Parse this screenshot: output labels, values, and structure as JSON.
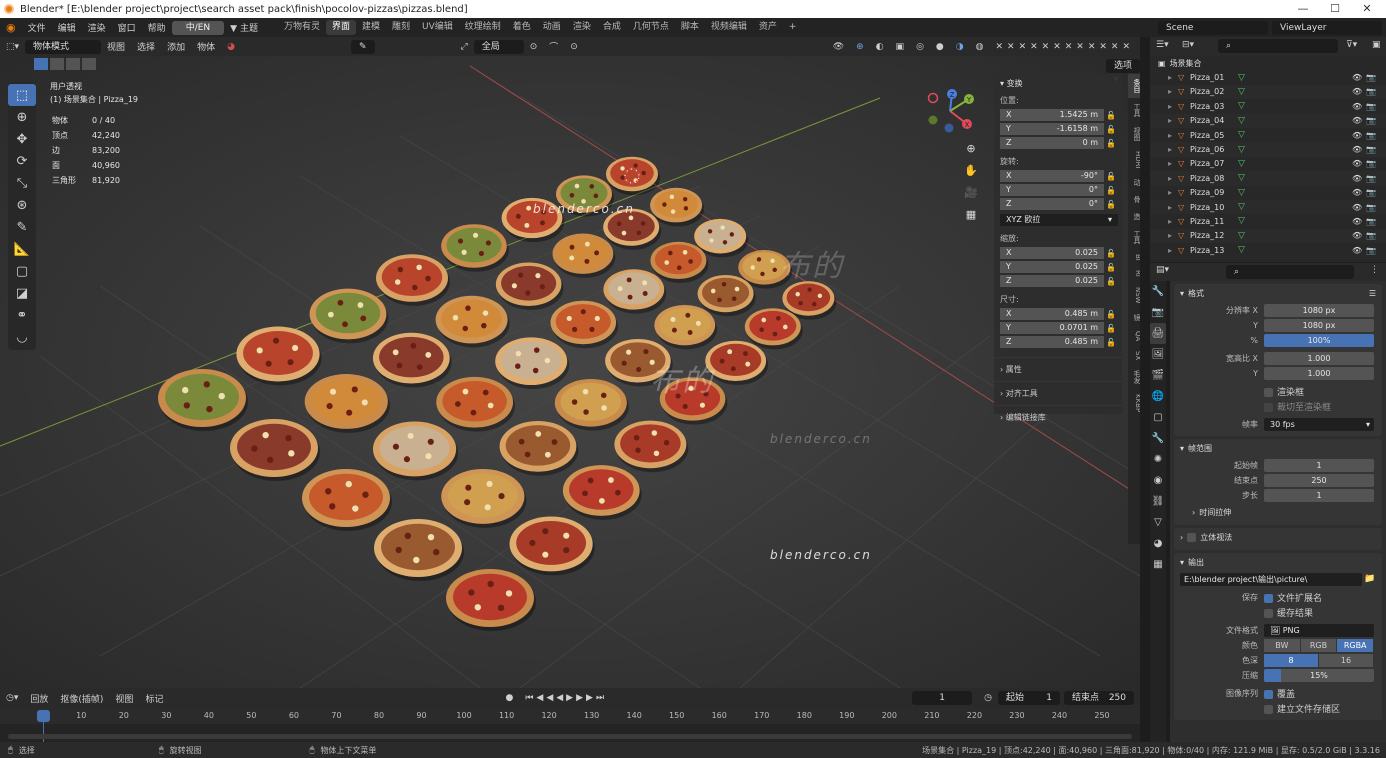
{
  "window": {
    "title": "Blender* [E:\\blender project\\project\\search asset pack\\finish\\pocolov-pizzas\\pizzas.blend]",
    "minimize": "—",
    "maximize": "☐",
    "close": "✕"
  },
  "menu": {
    "items": [
      "文件",
      "编辑",
      "渲染",
      "窗口",
      "帮助"
    ],
    "lang": "中/EN",
    "theme": "主题",
    "workspaces": [
      "万物有灵",
      "界面",
      "建模",
      "雕刻",
      "UV编辑",
      "纹理绘制",
      "着色",
      "动画",
      "渲染",
      "合成",
      "几何节点",
      "脚本",
      "视频编辑",
      "资产"
    ],
    "active_workspace": "界面",
    "add": "+",
    "scene": "Scene",
    "view_layer": "ViewLayer"
  },
  "viewport_header": {
    "mode": "物体模式",
    "items": [
      "视图",
      "选择",
      "添加",
      "物体"
    ],
    "transform": "全局",
    "options": "选项"
  },
  "viewport": {
    "view_name": "用户透视",
    "collection": "(1) 场景集合 | Pizza_19",
    "stats": [
      {
        "label": "物体",
        "value": "0 / 40"
      },
      {
        "label": "顶点",
        "value": "42,240"
      },
      {
        "label": "边",
        "value": "83,200"
      },
      {
        "label": "面",
        "value": "40,960"
      },
      {
        "label": "三角形",
        "value": "81,920"
      }
    ],
    "watermarks": [
      "blenderco.cn",
      "blenderco.cn",
      "blenderco.cn",
      "布的",
      "布的"
    ],
    "pizza_count": 40
  },
  "npanel": {
    "transform_title": "变换",
    "location_label": "位置:",
    "location": [
      {
        "axis": "X",
        "value": "1.5425 m"
      },
      {
        "axis": "Y",
        "value": "-1.6158 m"
      },
      {
        "axis": "Z",
        "value": "0 m"
      }
    ],
    "rotation_label": "旋转:",
    "rotation": [
      {
        "axis": "X",
        "value": "-90°"
      },
      {
        "axis": "Y",
        "value": "0°"
      },
      {
        "axis": "Z",
        "value": "0°"
      }
    ],
    "rotation_mode": "XYZ 欧拉",
    "scale_label": "缩放:",
    "scale": [
      {
        "axis": "X",
        "value": "0.025"
      },
      {
        "axis": "Y",
        "value": "0.025"
      },
      {
        "axis": "Z",
        "value": "0.025"
      }
    ],
    "dimensions_label": "尺寸:",
    "dimensions": [
      {
        "axis": "X",
        "value": "0.485 m"
      },
      {
        "axis": "Y",
        "value": "0.0701 m"
      },
      {
        "axis": "Z",
        "value": "0.485 m"
      }
    ],
    "sections": [
      "属性",
      "对齐工具",
      "编辑链接库"
    ],
    "tabs": [
      "条目",
      "工具",
      "视图",
      "HDRI",
      "动",
      "骨",
      "造",
      "工具",
      "Bl",
      "Ri",
      "NSW",
      "镜",
      "QA",
      "SX",
      "毛发",
      "KKBP"
    ]
  },
  "timeline": {
    "menus": [
      "回放",
      "抠像(插帧)",
      "视图",
      "标记"
    ],
    "current_frame": "1",
    "start_label": "起始",
    "start": "1",
    "end_label": "结束点",
    "end": "250",
    "ticks": [
      "1",
      "10",
      "20",
      "30",
      "40",
      "50",
      "60",
      "70",
      "80",
      "90",
      "100",
      "110",
      "120",
      "130",
      "140",
      "150",
      "160",
      "170",
      "180",
      "190",
      "200",
      "210",
      "220",
      "230",
      "240",
      "250"
    ]
  },
  "statusbar": {
    "select": "选择",
    "rotate": "旋转视图",
    "context": "物体上下文菜单",
    "stats": "场景集合 | Pizza_19 | 顶点:42,240 | 面:40,960 | 三角面:81,920 | 物体:0/40 | 内存: 121.9 MiB | 显存: 0.5/2.0 GiB | 3.3.16"
  },
  "outliner": {
    "root": "场景集合",
    "items": [
      "Pizza_01",
      "Pizza_02",
      "Pizza_03",
      "Pizza_04",
      "Pizza_05",
      "Pizza_06",
      "Pizza_07",
      "Pizza_08",
      "Pizza_09",
      "Pizza_10",
      "Pizza_11",
      "Pizza_12",
      "Pizza_13"
    ]
  },
  "properties": {
    "format": {
      "title": "格式",
      "res_x_label": "分辨率 X",
      "res_x": "1080 px",
      "res_y_label": "Y",
      "res_y": "1080 px",
      "percent_label": "%",
      "percent": "100%",
      "aspect_x_label": "宽高比 X",
      "aspect_x": "1.000",
      "aspect_y_label": "Y",
      "aspect_y": "1.000",
      "render_region": "渲染框",
      "crop": "裁切至渲染框",
      "fps_label": "帧率",
      "fps": "30 fps"
    },
    "frame_range": {
      "title": "帧范围",
      "start_label": "起始帧",
      "start": "1",
      "end_label": "结束点",
      "end": "250",
      "step_label": "步长",
      "step": "1",
      "time_stretch": "时间拉伸"
    },
    "stereo": "立体视法",
    "output": {
      "title": "输出",
      "path": "E:\\blender project\\输出\\picture\\",
      "save_label": "保存",
      "file_ext": "文件扩展名",
      "cache": "缓存结果",
      "file_format_label": "文件格式",
      "file_format": "PNG",
      "color_label": "颜色",
      "color_modes": [
        "BW",
        "RGB",
        "RGBA"
      ],
      "color_active": "RGBA",
      "depth_label": "色深",
      "depths": [
        "8",
        "16"
      ],
      "compression_label": "压缩",
      "compression": "15%",
      "compression_fraction": 0.15,
      "image_seq_label": "图像序列",
      "overwrite": "覆盖",
      "placeholders": "建立文件存储区"
    }
  }
}
